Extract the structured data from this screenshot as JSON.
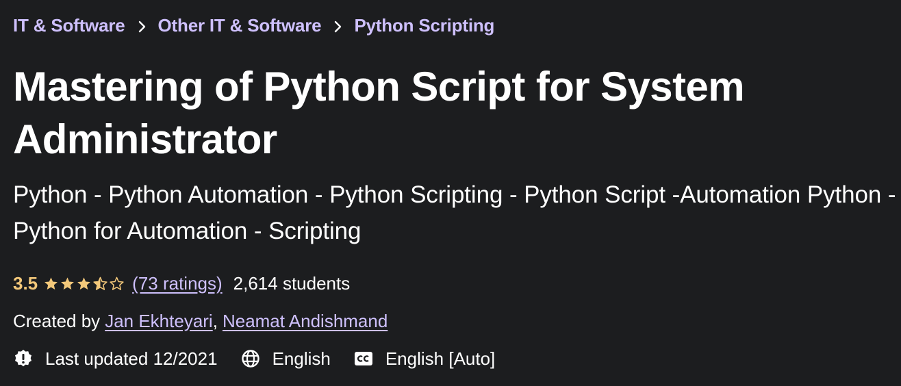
{
  "breadcrumb": {
    "items": [
      {
        "label": "IT & Software"
      },
      {
        "label": "Other IT & Software"
      },
      {
        "label": "Python Scripting"
      }
    ]
  },
  "course": {
    "title": "Mastering of Python Script for System Administrator",
    "subtitle": "Python - Python Automation - Python Scripting - Python Script -Automation Python - Python for Automation - Scripting",
    "rating": {
      "value": "3.5",
      "stars": 3.5,
      "max_stars": 5,
      "ratings_text": "(73 ratings)",
      "students_text": "2,614 students"
    },
    "created_by_label": "Created by",
    "authors": [
      "Jan Ekhteyari",
      "Neamat Andishmand"
    ],
    "author_separator": ",",
    "meta": {
      "last_updated": "Last updated 12/2021",
      "language": "English",
      "captions": "English [Auto]"
    }
  },
  "icons": {
    "breadcrumb_separator": "chevron-right-icon",
    "star": "star-icon",
    "last_updated": "alert-badge-icon",
    "language": "globe-icon",
    "captions": "closed-captions-icon"
  },
  "colors": {
    "background": "#1c1d1f",
    "link": "#cec0fc",
    "rating": "#f3c87a",
    "text": "#ffffff"
  }
}
